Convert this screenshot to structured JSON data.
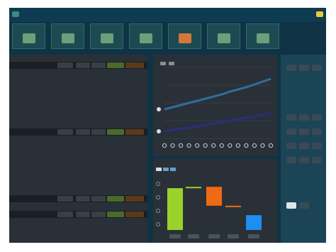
{
  "window": {
    "title": "",
    "left_icon": "app-logo-icon",
    "right_icon": "badge-icon",
    "colors": {
      "titlebar": "#0e3b52",
      "background": "#0f3345"
    }
  },
  "tiles": [
    {
      "label": "",
      "icon": "tile-icon"
    },
    {
      "label": "",
      "icon": "tile-icon"
    },
    {
      "label": "",
      "icon": "tile-icon"
    },
    {
      "label": "",
      "icon": "tile-icon"
    },
    {
      "label": "",
      "icon": "tile-icon",
      "accent": true
    },
    {
      "label": "",
      "icon": "tile-icon"
    },
    {
      "label": "",
      "icon": "tile-icon"
    }
  ],
  "left_panel": {
    "section_titles": [
      "",
      "",
      "",
      ""
    ],
    "tables": [
      {
        "headers": [
          "",
          "",
          "",
          "",
          ""
        ],
        "rows": [
          {
            "label": "",
            "values": [
              "",
              "",
              "",
              "",
              ""
            ]
          },
          {
            "label": "",
            "values": [
              "",
              "",
              "",
              "",
              ""
            ]
          },
          {
            "label": "",
            "values": [
              "",
              "",
              "",
              "",
              ""
            ]
          },
          {
            "label": "",
            "values": [
              "",
              "",
              "",
              "",
              ""
            ]
          },
          {
            "label": "",
            "values": [
              "",
              "",
              "",
              "",
              ""
            ]
          },
          {
            "label": "",
            "values": [
              "",
              "",
              "",
              "",
              ""
            ]
          },
          {
            "label": "",
            "values": [
              "",
              "",
              "",
              "",
              ""
            ]
          },
          {
            "label": "",
            "values": [
              "",
              "",
              "",
              "",
              ""
            ]
          }
        ]
      },
      {
        "headers": [
          "",
          "",
          "",
          "",
          ""
        ],
        "rows": [
          {
            "label": "",
            "values": [
              "",
              "",
              "",
              "",
              ""
            ]
          },
          {
            "label": "",
            "values": [
              "",
              "",
              "",
              "",
              ""
            ]
          },
          {
            "label": "",
            "values": [
              "",
              "",
              "",
              "",
              ""
            ]
          },
          {
            "label": "",
            "values": [
              "",
              "",
              "",
              "",
              ""
            ]
          },
          {
            "label": "",
            "values": [
              "",
              "",
              "",
              "",
              ""
            ]
          },
          {
            "label": "",
            "values": [
              "",
              "",
              "",
              "",
              ""
            ]
          },
          {
            "label": "",
            "values": [
              "",
              "",
              "",
              "",
              ""
            ]
          },
          {
            "label": "",
            "values": [
              "",
              "",
              "",
              "",
              ""
            ]
          }
        ]
      },
      {
        "headers": [
          "",
          "",
          "",
          "",
          ""
        ],
        "rows": []
      },
      {
        "headers": [
          "",
          "",
          "",
          "",
          ""
        ],
        "rows": []
      }
    ]
  },
  "line_chart": {
    "title": "",
    "legend": [
      "",
      ""
    ],
    "x_tick_count": 14
  },
  "bar_chart": {
    "title": "",
    "legend": [
      "",
      "",
      ""
    ],
    "categories": [
      "",
      "",
      "",
      "",
      ""
    ]
  },
  "right_panel": {
    "labels": [
      "",
      "",
      ""
    ],
    "button_rows": [
      3,
      3,
      3,
      3,
      3,
      3,
      2
    ]
  },
  "chart_data": [
    {
      "type": "line",
      "title": "",
      "x": [
        1,
        2,
        3,
        4,
        5,
        6,
        7,
        8,
        9,
        10,
        11,
        12,
        13,
        14
      ],
      "series": [
        {
          "values": [
            41,
            44,
            47,
            50,
            53,
            56,
            59,
            62,
            66,
            69,
            72,
            76,
            80,
            84
          ],
          "color": "#2f6f9a"
        },
        {
          "values": [
            10,
            12,
            14,
            15,
            17,
            19,
            21,
            23,
            25,
            27,
            29,
            31,
            33,
            36
          ],
          "color": "#2a2f7a"
        }
      ],
      "ylim": [
        0,
        100
      ],
      "grid": true
    },
    {
      "type": "bar",
      "title": "",
      "categories": [
        "",
        "",
        "",
        "",
        ""
      ],
      "bars": [
        {
          "start": 0,
          "end": 62,
          "color": "#9ad12b"
        },
        {
          "start": 62,
          "end": 64,
          "color": "#9ad12b"
        },
        {
          "start": 64,
          "end": 36,
          "color": "#f06a14"
        },
        {
          "start": 36,
          "end": 36,
          "color": "#f06a14"
        },
        {
          "start": 0,
          "end": 22,
          "color": "#1e8ef0"
        }
      ],
      "ylim": [
        0,
        80
      ],
      "grid": false
    }
  ]
}
